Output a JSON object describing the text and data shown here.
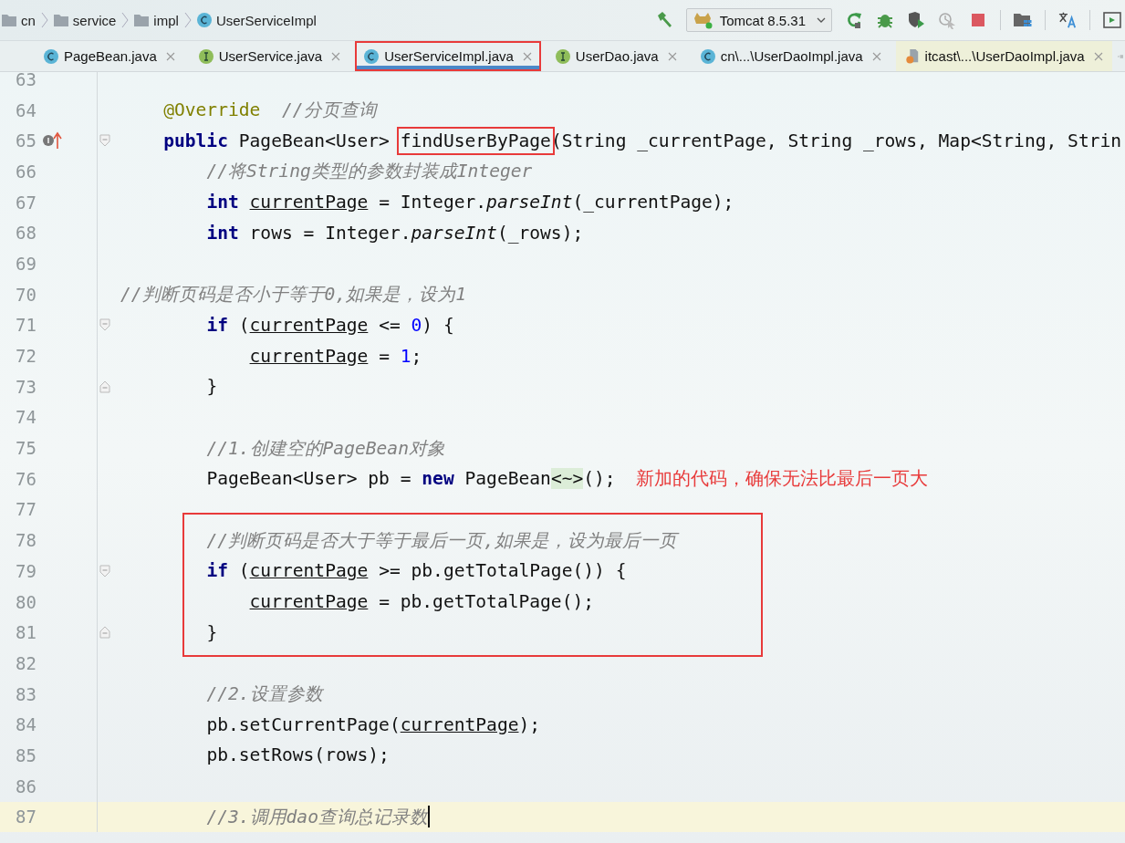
{
  "breadcrumbs": [
    {
      "label": "cn",
      "kind": "folder"
    },
    {
      "label": "service",
      "kind": "folder"
    },
    {
      "label": "impl",
      "kind": "folder"
    },
    {
      "label": "UserServiceImpl",
      "kind": "class"
    }
  ],
  "run_config": {
    "label": "Tomcat 8.5.31"
  },
  "tabs": [
    {
      "label": "PageBean.java",
      "kind": "class",
      "selected": false,
      "annotated": false
    },
    {
      "label": "UserService.java",
      "kind": "interface",
      "selected": false,
      "annotated": false
    },
    {
      "label": "UserServiceImpl.java",
      "kind": "class",
      "selected": true,
      "annotated": true
    },
    {
      "label": "UserDao.java",
      "kind": "interface",
      "selected": false,
      "annotated": false
    },
    {
      "label": "cn\\...\\UserDaoImpl.java",
      "kind": "class",
      "selected": false,
      "annotated": false
    },
    {
      "label": "itcast\\...\\UserDaoImpl.java",
      "kind": "jsp",
      "selected": false,
      "annotated": false
    }
  ],
  "blocks": [
    {
      "annotated": false,
      "lines": [
        {
          "number": "63"
        },
        {
          "number": "64",
          "tokens": [
            {
              "kind": "annotation",
              "text": "    @Override"
            },
            {
              "kind": "comment",
              "text": "  //分页查询"
            }
          ]
        },
        {
          "number": "65",
          "implements_marker": true,
          "fold_start": true,
          "tokens": [
            {
              "kind": "keyword",
              "text": "    public"
            },
            {
              "kind": "plain",
              "text": " PageBean<User> "
            },
            {
              "kind": "boxed",
              "text": "findUserByPage"
            },
            {
              "kind": "plain",
              "text": "(String _currentPage, String _rows, Map<String, Strin"
            }
          ]
        },
        {
          "number": "66",
          "tokens": [
            {
              "kind": "comment",
              "text": "        //将String类型的参数封装成Integer"
            }
          ]
        },
        {
          "number": "67",
          "tokens": [
            {
              "kind": "keyword",
              "text": "        int"
            },
            {
              "kind": "var",
              "text": " currentPage"
            },
            {
              "kind": "plain",
              "text": " = Integer."
            },
            {
              "kind": "static",
              "text": "parseInt"
            },
            {
              "kind": "plain",
              "text": "(_currentPage);"
            }
          ]
        },
        {
          "number": "68",
          "tokens": [
            {
              "kind": "keyword",
              "text": "        int"
            },
            {
              "kind": "plain",
              "text": " rows = Integer."
            },
            {
              "kind": "static",
              "text": "parseInt"
            },
            {
              "kind": "plain",
              "text": "(_rows);"
            }
          ]
        },
        {
          "number": "69"
        },
        {
          "number": "70",
          "tokens": [
            {
              "kind": "comment",
              "text": "//判断页码是否小于等于0,如果是，设为1"
            }
          ]
        },
        {
          "number": "71",
          "fold_start": true,
          "tokens": [
            {
              "kind": "keyword",
              "text": "        if"
            },
            {
              "kind": "plain",
              "text": " ("
            },
            {
              "kind": "var",
              "text": "currentPage"
            },
            {
              "kind": "plain",
              "text": " <= "
            },
            {
              "kind": "number",
              "text": "0"
            },
            {
              "kind": "plain",
              "text": ") {"
            }
          ]
        },
        {
          "number": "72",
          "tokens": [
            {
              "kind": "var",
              "text": "            currentPage"
            },
            {
              "kind": "plain",
              "text": " = "
            },
            {
              "kind": "number",
              "text": "1"
            },
            {
              "kind": "plain",
              "text": ";"
            }
          ]
        },
        {
          "number": "73",
          "fold_end": true,
          "tokens": [
            {
              "kind": "plain",
              "text": "        }"
            }
          ]
        },
        {
          "number": "74"
        },
        {
          "number": "75",
          "tokens": [
            {
              "kind": "comment",
              "text": "        //1.创建空的PageBean对象"
            }
          ]
        },
        {
          "number": "76",
          "note": "新加的代码，确保无法比最后一页大",
          "tokens": [
            {
              "kind": "plain",
              "text": "        PageBean<User> pb = "
            },
            {
              "kind": "keyword",
              "text": "new"
            },
            {
              "kind": "plain",
              "text": " PageBean"
            },
            {
              "kind": "folded",
              "text": "<~>"
            },
            {
              "kind": "plain",
              "text": "();"
            }
          ]
        },
        {
          "number": "77"
        }
      ]
    },
    {
      "annotated": true,
      "lines": [
        {
          "number": "78",
          "tokens": [
            {
              "kind": "comment",
              "text": "        //判断页码是否大于等于最后一页,如果是，设为最后一页"
            }
          ]
        },
        {
          "number": "79",
          "fold_start": true,
          "tokens": [
            {
              "kind": "keyword",
              "text": "        if"
            },
            {
              "kind": "plain",
              "text": " ("
            },
            {
              "kind": "var",
              "text": "currentPage"
            },
            {
              "kind": "plain",
              "text": " >= pb.getTotalPage()) {"
            }
          ]
        },
        {
          "number": "80",
          "tokens": [
            {
              "kind": "var",
              "text": "            currentPage"
            },
            {
              "kind": "plain",
              "text": " = pb.getTotalPage();"
            }
          ]
        },
        {
          "number": "81",
          "fold_end": true,
          "tokens": [
            {
              "kind": "plain",
              "text": "        }"
            }
          ]
        }
      ]
    },
    {
      "annotated": false,
      "lines": [
        {
          "number": "82"
        },
        {
          "number": "83",
          "tokens": [
            {
              "kind": "comment",
              "text": "        //2.设置参数"
            }
          ]
        },
        {
          "number": "84",
          "tokens": [
            {
              "kind": "plain",
              "text": "        pb.setCurrentPage("
            },
            {
              "kind": "var",
              "text": "currentPage"
            },
            {
              "kind": "plain",
              "text": ");"
            }
          ]
        },
        {
          "number": "85",
          "tokens": [
            {
              "kind": "plain",
              "text": "        pb.setRows(rows);"
            }
          ]
        },
        {
          "number": "86"
        },
        {
          "number": "87",
          "current": true,
          "tokens": [
            {
              "kind": "comment",
              "text": "        //3.调用dao查询总记录数"
            }
          ]
        }
      ]
    }
  ]
}
